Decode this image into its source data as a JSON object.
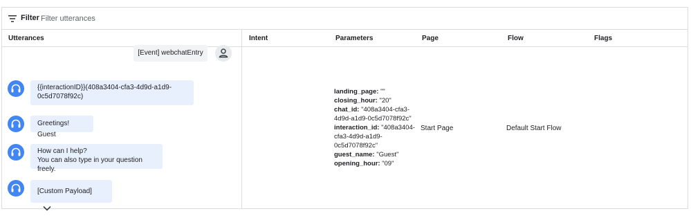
{
  "filter": {
    "label": "Filter",
    "placeholder": "Filter utterances"
  },
  "columns": {
    "utterances": "Utterances",
    "intent": "Intent",
    "parameters": "Parameters",
    "page": "Page",
    "flow": "Flow",
    "flags": "Flags"
  },
  "conversation": {
    "user_event": "[Event] webchatEntry",
    "agent_messages": [
      {
        "line1": "{{interactionID}}(408a3404-cfa3-4d9d-a1d9-",
        "line2": "0c5d7078f92c)"
      },
      {
        "line1": "Greetings! Guest"
      },
      {
        "line1": "How can I help?",
        "line2": "You can also type in your question freely."
      },
      {
        "line1": "[Custom Payload]"
      }
    ]
  },
  "row": {
    "parameters": [
      {
        "key": "landing_page:",
        "value": " \"\""
      },
      {
        "key": "closing_hour:",
        "value": " \"20\""
      },
      {
        "key": "chat_id:",
        "value": " \"408a3404-cfa3-4d9d-a1d9-0c5d7078f92c\""
      },
      {
        "key": "interaction_id:",
        "value": " \"408a3404-cfa3-4d9d-a1d9-0c5d7078f92c\""
      },
      {
        "key": "guest_name:",
        "value": " \"Guest\""
      },
      {
        "key": "opening_hour:",
        "value": " \"09\""
      }
    ],
    "page": "Start Page",
    "flow": "Default Start Flow"
  },
  "icons": {
    "filter": "filter-icon",
    "user": "person-icon",
    "agent": "headset-icon",
    "expand": "chevron-down-icon"
  },
  "colors": {
    "agent_avatar": "#4285f4",
    "agent_bubble": "#e8f0fe",
    "user_bubble": "#f1f3f4",
    "border": "#dadce0"
  }
}
